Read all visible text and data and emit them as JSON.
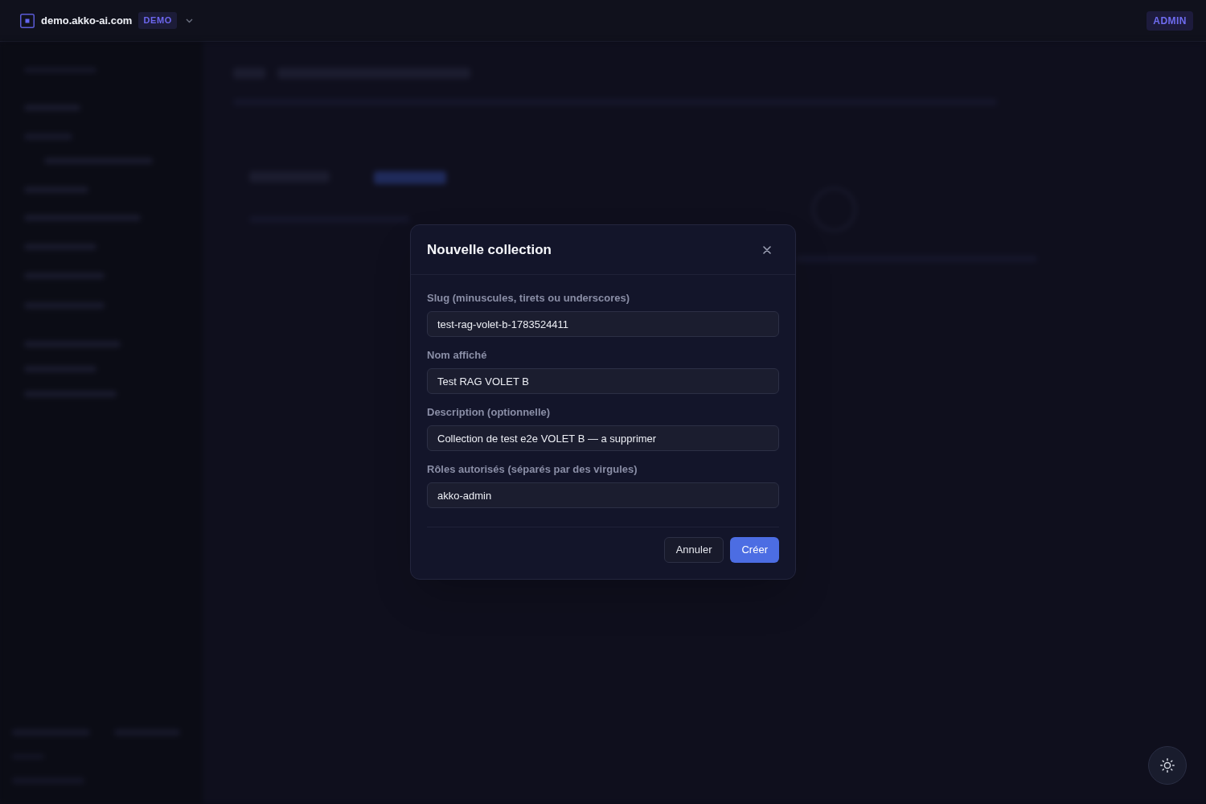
{
  "top_bar": {
    "domain": "demo.akko-ai.com",
    "environment_badge": "DEMO",
    "role_badge": "ADMIN"
  },
  "dialog": {
    "title": "Nouvelle collection",
    "fields": [
      {
        "label": "Slug (minuscules, tirets ou underscores)",
        "value": "test-rag-volet-b-1783524411"
      },
      {
        "label": "Nom affiché",
        "value": "Test RAG VOLET B"
      },
      {
        "label": "Description (optionnelle)",
        "value": "Collection de test e2e VOLET B — a supprimer"
      },
      {
        "label": "Rôles autorisés (séparés par des virgules)",
        "value": "akko-admin"
      }
    ],
    "buttons": [
      {
        "label": "Annuler",
        "kind": "secondary"
      },
      {
        "label": "Créer",
        "kind": "primary"
      }
    ]
  }
}
